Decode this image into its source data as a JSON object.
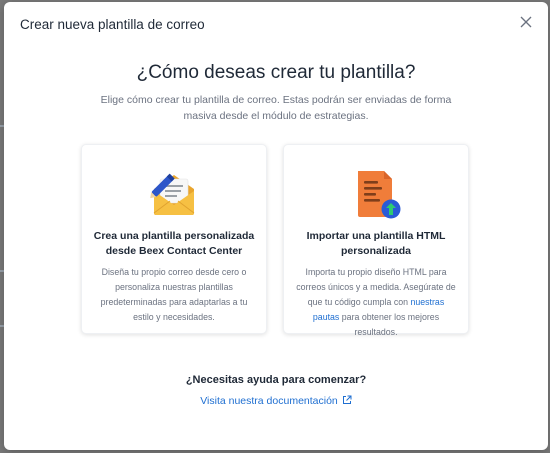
{
  "modal": {
    "title": "Crear nueva plantilla de correo",
    "close_icon": "close-icon"
  },
  "main": {
    "headline": "¿Cómo deseas crear tu plantilla?",
    "intro": "Elige cómo crear tu plantilla de correo. Estas podrán ser enviadas de forma masiva desde el módulo de estrategias."
  },
  "cards": [
    {
      "icon": "email-edit-icon",
      "title": "Crea una plantilla personalizada desde Beex Contact Center",
      "description": "Diseña tu propio correo desde cero o personaliza nuestras plantillas predeterminadas para adaptarlas a tu estilo y necesidades."
    },
    {
      "icon": "html-upload-icon",
      "title": "Importar una plantilla HTML personalizada",
      "description_before": "Importa tu propio diseño HTML para correos únicos y a medida. Asegúrate de que tu código cumpla con",
      "description_link": "nuestras pautas",
      "description_after": "para obtener los mejores resultados."
    }
  ],
  "help": {
    "title": "¿Necesitas ayuda para comenzar?",
    "link_label": "Visita nuestra documentación",
    "link_icon": "external-link-icon"
  },
  "colors": {
    "accent": "#1f6fd1",
    "envelope": "#f3b73b",
    "document": "#f07d3a",
    "upload_badge": "#2a5bd7",
    "upload_arrow": "#2ecc71"
  }
}
